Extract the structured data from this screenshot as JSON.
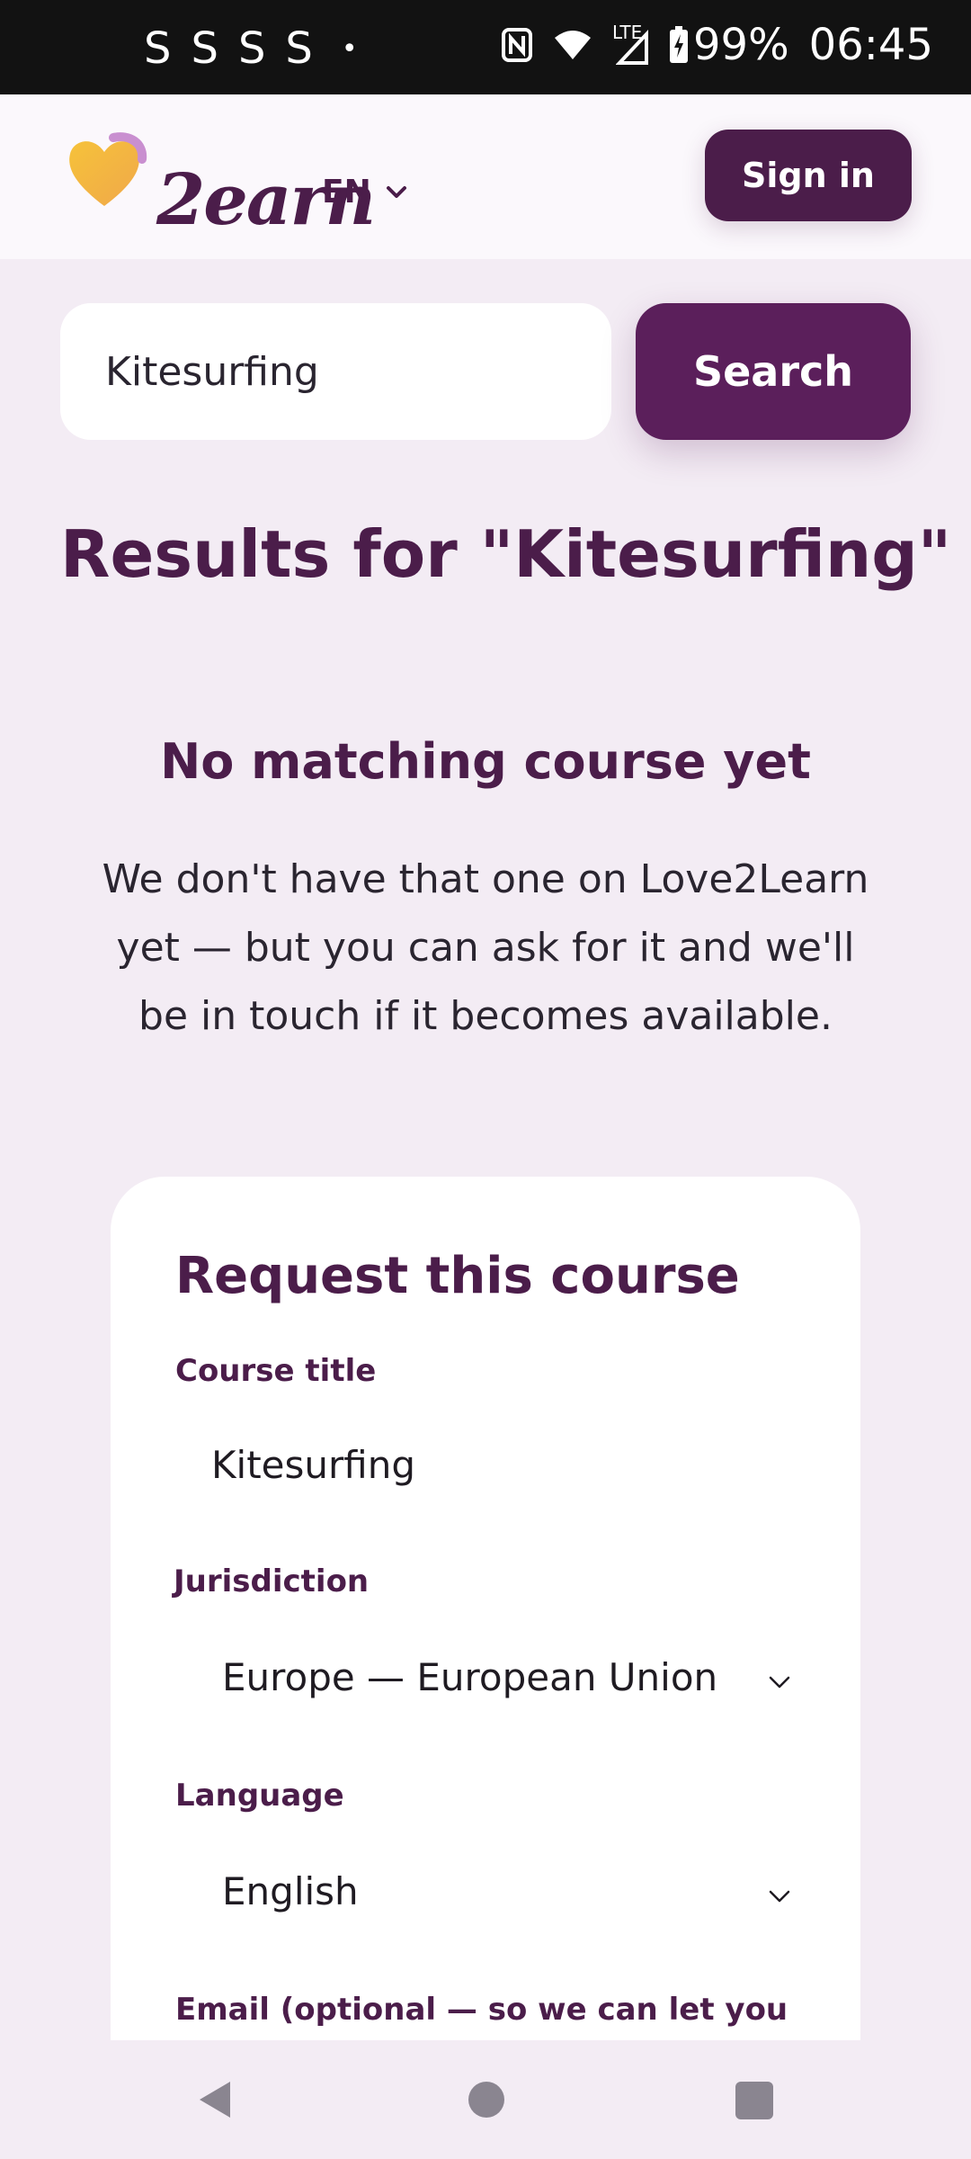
{
  "status_bar": {
    "left_icons": [
      "S",
      "S",
      "S",
      "S"
    ],
    "dot": "•",
    "lte": "LTE",
    "battery": "99%",
    "time": "06:45"
  },
  "header": {
    "logo_text": "2earn",
    "language": "EN",
    "signin_label": "Sign in"
  },
  "search": {
    "value": "Kitesurfing",
    "button_label": "Search"
  },
  "results_title": "Results for \"Kitesurfing\"",
  "no_match": {
    "title": "No matching course yet",
    "text": "We don't have that one on Love2Learn yet — but you can ask for it and we'll be in touch if it becomes available."
  },
  "request_form": {
    "title": "Request this course",
    "course_title_label": "Course title",
    "course_title_value": "Kitesurfing",
    "jurisdiction_label": "Jurisdiction",
    "jurisdiction_value": "Europe — European Union (g",
    "language_label": "Language",
    "language_value": "English",
    "email_label": "Email (optional — so we can let you"
  },
  "colors": {
    "brand": "#4b1d4a",
    "search_button": "#5b1f5b",
    "background": "#f3ecf4"
  }
}
